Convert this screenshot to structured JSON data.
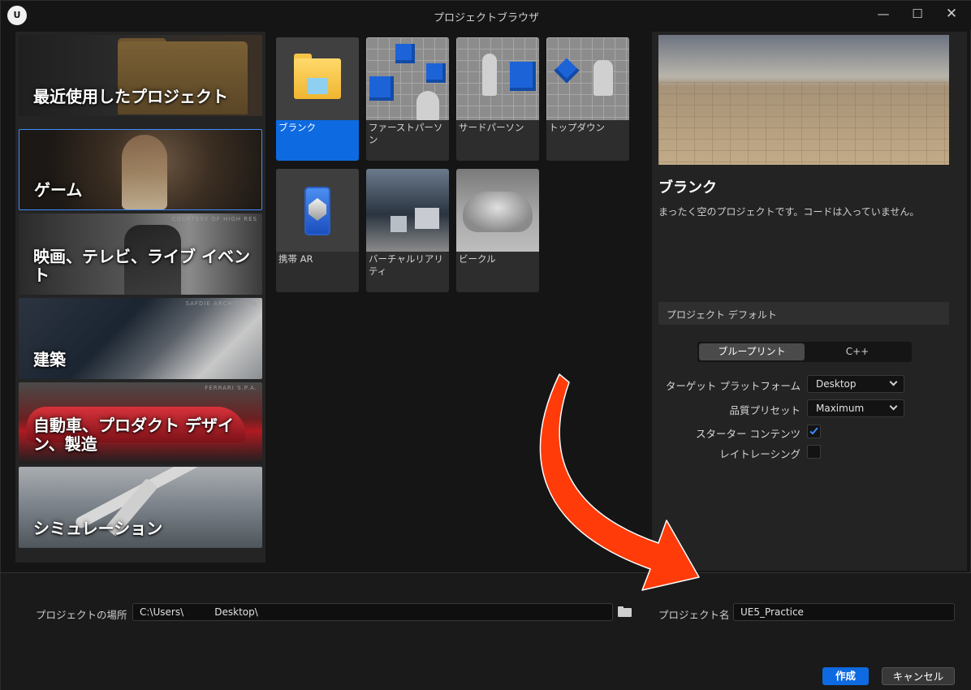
{
  "window": {
    "logo_text": "U",
    "title": "プロジェクトブラウザ",
    "controls": {
      "minimize": "—",
      "maximize": "☐",
      "close": "✕"
    }
  },
  "categories": [
    {
      "label": "最近使用したプロジェクト",
      "credit": ""
    },
    {
      "label": "ゲーム",
      "credit": ""
    },
    {
      "label": "映画、テレビ、ライブ イベント",
      "credit": "COURTESY OF HIGH RES"
    },
    {
      "label": "建築",
      "credit": "SAFDIE ARCHITECTS"
    },
    {
      "label": "自動車、プロダクト デザイン、製造",
      "credit": "FERRARI S.P.A."
    },
    {
      "label": "シミュレーション",
      "credit": ""
    }
  ],
  "templates": [
    {
      "label": "ブランク",
      "selected": true
    },
    {
      "label": "ファーストパーソン"
    },
    {
      "label": "サードパーソン"
    },
    {
      "label": "トップダウン"
    },
    {
      "label": "携帯 AR"
    },
    {
      "label": "バーチャルリアリティ"
    },
    {
      "label": "ビークル"
    }
  ],
  "details": {
    "title": "ブランク",
    "description": "まったく空のプロジェクトです。コードは入っていません。",
    "section_title": "プロジェクト デフォルト",
    "mode_options": [
      "ブループリント",
      "C++"
    ],
    "selected_mode": "ブループリント",
    "target_platform": {
      "label": "ターゲット プラットフォーム",
      "value": "Desktop"
    },
    "quality_preset": {
      "label": "品質プリセット",
      "value": "Maximum"
    },
    "starter_content": {
      "label": "スターター コンテンツ",
      "checked": true
    },
    "ray_tracing": {
      "label": "レイトレーシング",
      "checked": false
    }
  },
  "bottom": {
    "location_label": "プロジェクトの場所",
    "location_value": "C:\\Users\\          Desktop\\",
    "name_label": "プロジェクト名",
    "name_value": "UE5_Practice",
    "create_label": "作成",
    "cancel_label": "キャンセル"
  },
  "colors": {
    "accent": "#0e6ae0",
    "annotation_arrow": "#ff3b0a"
  }
}
